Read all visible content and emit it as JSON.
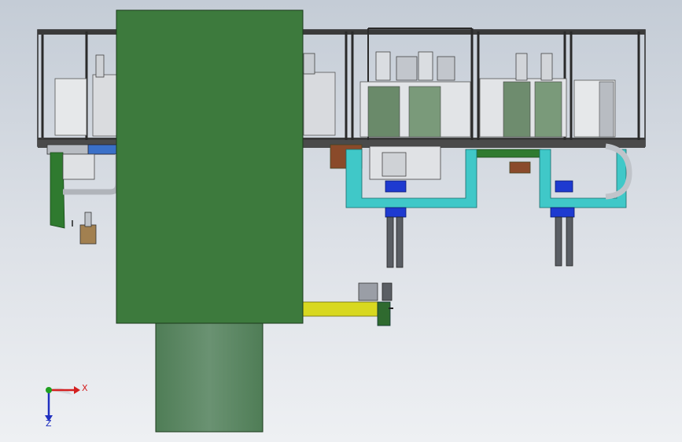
{
  "window": {
    "background_top": "#c4ccd6",
    "background_bottom": "#eef0f3"
  },
  "colors": {
    "green_panel": "#3d7a3d",
    "green_cylinder": "#5a8a62",
    "frame": "#2a2a2a",
    "cyan_bracket": "#40c8c8",
    "blue_actuator": "#1e3ad0",
    "yellow_arm": "#d8d820",
    "dark_green_part": "#2f7a2f",
    "brown_part": "#8a4a2a"
  },
  "triad": {
    "x_label": "X",
    "z_label": "Z",
    "x_color": "#d42020",
    "z_color": "#2030c0",
    "origin_color": "#20a020"
  }
}
